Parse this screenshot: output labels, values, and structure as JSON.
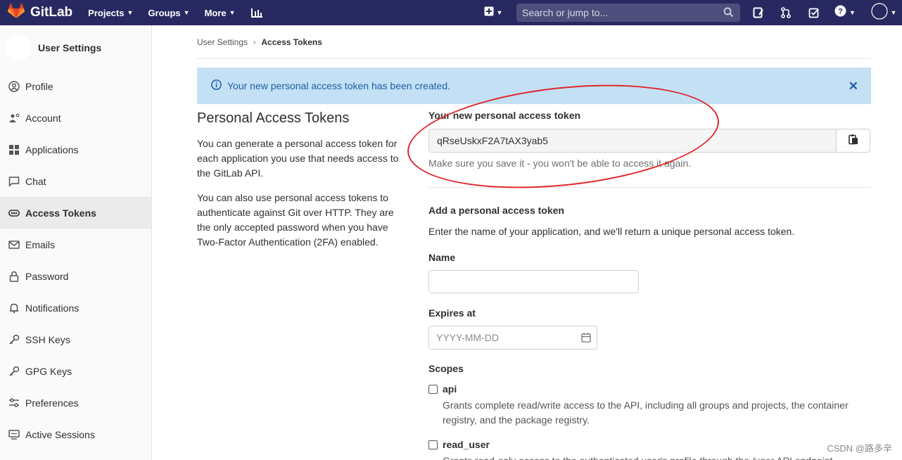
{
  "navbar": {
    "brand": "GitLab",
    "menu": [
      {
        "label": "Projects",
        "dropdown": true
      },
      {
        "label": "Groups",
        "dropdown": true
      },
      {
        "label": "More",
        "dropdown": true
      }
    ],
    "search_placeholder": "Search or jump to...",
    "bg_color": "#292961"
  },
  "sidebar": {
    "title": "User Settings",
    "items": [
      {
        "label": "Profile",
        "icon": "profile-icon"
      },
      {
        "label": "Account",
        "icon": "account-icon"
      },
      {
        "label": "Applications",
        "icon": "applications-icon"
      },
      {
        "label": "Chat",
        "icon": "chat-icon"
      },
      {
        "label": "Access Tokens",
        "icon": "access-tokens-icon",
        "active": true
      },
      {
        "label": "Emails",
        "icon": "email-icon"
      },
      {
        "label": "Password",
        "icon": "lock-icon"
      },
      {
        "label": "Notifications",
        "icon": "bell-icon"
      },
      {
        "label": "SSH Keys",
        "icon": "key-icon"
      },
      {
        "label": "GPG Keys",
        "icon": "key-icon"
      },
      {
        "label": "Preferences",
        "icon": "preferences-icon"
      },
      {
        "label": "Active Sessions",
        "icon": "monitor-icon"
      }
    ]
  },
  "breadcrumb": {
    "parent": "User Settings",
    "current": "Access Tokens"
  },
  "alert": {
    "message": "Your new personal access token has been created.",
    "bg_color": "#c4e0f5"
  },
  "intro": {
    "title": "Personal Access Tokens",
    "paragraph1": "You can generate a personal access token for each application you use that needs access to the GitLab API.",
    "paragraph2": "You can also use personal access tokens to authenticate against Git over HTTP. They are the only accepted password when you have Two-Factor Authentication (2FA) enabled."
  },
  "new_token": {
    "label": "Your new personal access token",
    "value": "qRseUskxF2A7tAX3yab5",
    "hint": "Make sure you save it - you won't be able to access it again."
  },
  "form": {
    "title": "Add a personal access token",
    "description": "Enter the name of your application, and we'll return a unique personal access token.",
    "name_label": "Name",
    "name_value": "",
    "expires_label": "Expires at",
    "expires_placeholder": "YYYY-MM-DD",
    "scopes_label": "Scopes",
    "scopes": [
      {
        "name": "api",
        "checked": false,
        "description": "Grants complete read/write access to the API, including all groups and projects, the container registry, and the package registry."
      },
      {
        "name": "read_user",
        "checked": false,
        "description": "Grants read-only access to the authenticated user's profile through the /user API endpoint"
      }
    ]
  },
  "watermark": "CSDN @路多辛"
}
